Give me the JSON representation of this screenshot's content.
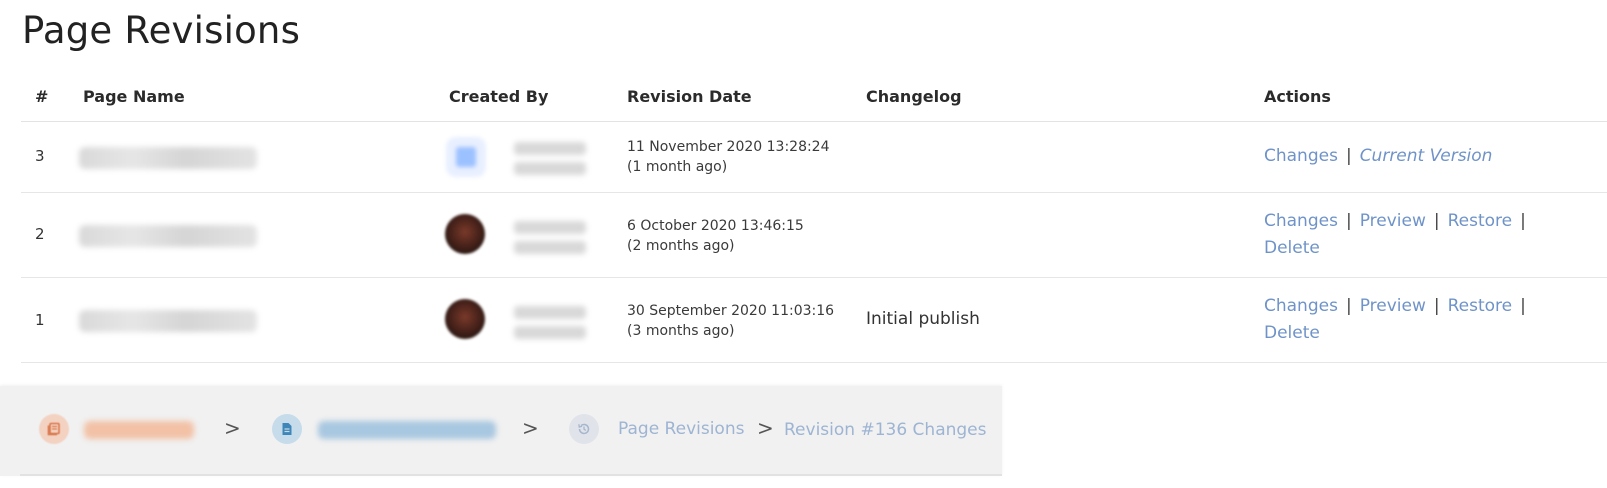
{
  "page": {
    "title": "Page Revisions"
  },
  "table": {
    "headers": {
      "num": "#",
      "page_name": "Page Name",
      "created_by": "Created By",
      "revision_date": "Revision Date",
      "changelog": "Changelog",
      "actions": "Actions"
    },
    "rows": [
      {
        "num": "3",
        "date": "11 November 2020 13:28:24",
        "relative": "(1 month ago)",
        "changelog": "",
        "actions": {
          "changes": "Changes",
          "current": "Current Version"
        }
      },
      {
        "num": "2",
        "date": "6 October 2020 13:46:15",
        "relative": "(2 months ago)",
        "changelog": "",
        "actions": {
          "changes": "Changes",
          "preview": "Preview",
          "restore": "Restore",
          "delete": "Delete"
        }
      },
      {
        "num": "1",
        "date": "30 September 2020 11:03:16",
        "relative": "(3 months ago)",
        "changelog": "Initial publish",
        "actions": {
          "changes": "Changes",
          "preview": "Preview",
          "restore": "Restore",
          "delete": "Delete"
        }
      }
    ],
    "separator": "|"
  },
  "breadcrumb": {
    "icons": {
      "book": "book-icon",
      "page": "page-icon",
      "history": "history-icon"
    },
    "separator": ">",
    "revisions_label": "Page Revisions",
    "current_label": "Revision #136 Changes"
  },
  "colors": {
    "link": "#6f93c8",
    "breadcrumb_text": "#9db4d3",
    "book_accent": "#d9764a",
    "page_accent": "#3f86b8"
  }
}
